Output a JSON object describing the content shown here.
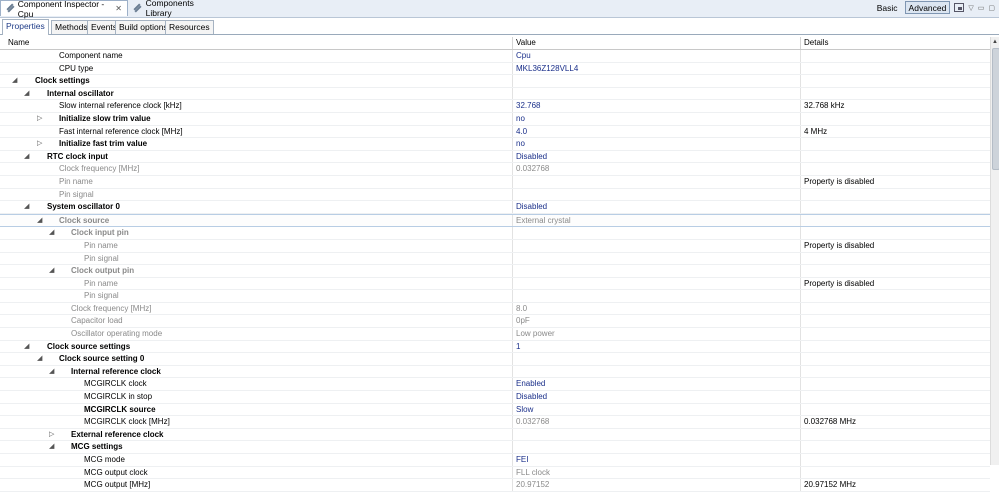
{
  "view_tabs": {
    "inspector": "Component Inspector - Cpu",
    "library": "Components Library",
    "basic": "Basic",
    "advanced": "Advanced"
  },
  "sub_tabs": [
    "Properties",
    "Methods",
    "Events",
    "Build options",
    "Resources"
  ],
  "columns": {
    "name": "Name",
    "value": "Value",
    "details": "Details"
  },
  "rows": [
    {
      "level": 2,
      "tw": "",
      "name": "Component name",
      "value": "Cpu",
      "details": "",
      "bold": false,
      "dis": false
    },
    {
      "level": 2,
      "tw": "",
      "name": "CPU type",
      "value": "MKL36Z128VLL4",
      "details": "",
      "bold": false,
      "dis": false
    },
    {
      "level": 0,
      "tw": "◢",
      "name": "Clock settings",
      "value": "",
      "details": "",
      "bold": true,
      "dis": false
    },
    {
      "level": 1,
      "tw": "◢",
      "name": "Internal oscillator",
      "value": "",
      "details": "",
      "bold": true,
      "dis": false
    },
    {
      "level": 2,
      "tw": "",
      "name": "Slow internal reference clock [kHz]",
      "value": "32.768",
      "details": "32.768 kHz",
      "bold": false,
      "dis": false
    },
    {
      "level": 2,
      "tw": "▷",
      "name": "Initialize slow trim value",
      "value": "no",
      "details": "",
      "bold": true,
      "dis": false
    },
    {
      "level": 2,
      "tw": "",
      "name": "Fast internal reference clock [MHz]",
      "value": "4.0",
      "details": "4 MHz",
      "bold": false,
      "dis": false
    },
    {
      "level": 2,
      "tw": "▷",
      "name": "Initialize fast trim value",
      "value": "no",
      "details": "",
      "bold": true,
      "dis": false
    },
    {
      "level": 1,
      "tw": "◢",
      "name": "RTC clock input",
      "value": "Disabled",
      "details": "",
      "bold": true,
      "dis": false
    },
    {
      "level": 2,
      "tw": "",
      "name": "Clock frequency [MHz]",
      "value": "0.032768",
      "details": "",
      "bold": false,
      "dis": true
    },
    {
      "level": 2,
      "tw": "",
      "name": "Pin name",
      "value": "",
      "details": "Property is disabled",
      "bold": false,
      "dis": true
    },
    {
      "level": 2,
      "tw": "",
      "name": "Pin signal",
      "value": "",
      "details": "",
      "bold": false,
      "dis": true
    },
    {
      "level": 1,
      "tw": "◢",
      "name": "System oscillator 0",
      "value": "Disabled",
      "details": "",
      "bold": true,
      "dis": false
    },
    {
      "level": 2,
      "tw": "◢",
      "name": "Clock source",
      "value": "External crystal",
      "details": "",
      "bold": true,
      "dis": true,
      "hl": true
    },
    {
      "level": 3,
      "tw": "◢",
      "name": "Clock input pin",
      "value": "",
      "details": "",
      "bold": true,
      "dis": true
    },
    {
      "level": 4,
      "tw": "",
      "name": "Pin name",
      "value": "",
      "details": "Property is disabled",
      "bold": false,
      "dis": true
    },
    {
      "level": 4,
      "tw": "",
      "name": "Pin signal",
      "value": "",
      "details": "",
      "bold": false,
      "dis": true
    },
    {
      "level": 3,
      "tw": "◢",
      "name": "Clock output pin",
      "value": "",
      "details": "",
      "bold": true,
      "dis": true
    },
    {
      "level": 4,
      "tw": "",
      "name": "Pin name",
      "value": "",
      "details": "Property is disabled",
      "bold": false,
      "dis": true
    },
    {
      "level": 4,
      "tw": "",
      "name": "Pin signal",
      "value": "",
      "details": "",
      "bold": false,
      "dis": true
    },
    {
      "level": 3,
      "tw": "",
      "name": "Clock frequency [MHz]",
      "value": "8.0",
      "details": "",
      "bold": false,
      "dis": true
    },
    {
      "level": 3,
      "tw": "",
      "name": "Capacitor load",
      "value": "0pF",
      "details": "",
      "bold": false,
      "dis": true
    },
    {
      "level": 3,
      "tw": "",
      "name": "Oscillator operating mode",
      "value": "Low power",
      "details": "",
      "bold": false,
      "dis": true
    },
    {
      "level": 1,
      "tw": "◢",
      "name": "Clock source settings",
      "value": "1",
      "details": "",
      "bold": true,
      "dis": false
    },
    {
      "level": 2,
      "tw": "◢",
      "name": "Clock source setting 0",
      "value": "",
      "details": "",
      "bold": true,
      "dis": false
    },
    {
      "level": 3,
      "tw": "◢",
      "name": "Internal reference clock",
      "value": "",
      "details": "",
      "bold": true,
      "dis": false
    },
    {
      "level": 4,
      "tw": "",
      "name": "MCGIRCLK clock",
      "value": "Enabled",
      "details": "",
      "bold": false,
      "dis": false
    },
    {
      "level": 4,
      "tw": "",
      "name": "MCGIRCLK in stop",
      "value": "Disabled",
      "details": "",
      "bold": false,
      "dis": false
    },
    {
      "level": 4,
      "tw": "",
      "name": "MCGIRCLK source",
      "value": "Slow",
      "details": "",
      "bold": true,
      "dis": false
    },
    {
      "level": 4,
      "tw": "",
      "name": "MCGIRCLK clock [MHz]",
      "value": "0.032768",
      "details": "0.032768 MHz",
      "bold": false,
      "dis": false,
      "vgray": true
    },
    {
      "level": 3,
      "tw": "▷",
      "name": "External reference clock",
      "value": "",
      "details": "",
      "bold": true,
      "dis": false
    },
    {
      "level": 3,
      "tw": "◢",
      "name": "MCG settings",
      "value": "",
      "details": "",
      "bold": true,
      "dis": false
    },
    {
      "level": 4,
      "tw": "",
      "name": "MCG mode",
      "value": "FEI",
      "details": "",
      "bold": false,
      "dis": false
    },
    {
      "level": 4,
      "tw": "",
      "name": "MCG output clock",
      "value": "FLL clock",
      "details": "",
      "bold": false,
      "dis": false,
      "vgray": true
    },
    {
      "level": 4,
      "tw": "",
      "name": "MCG output [MHz]",
      "value": "20.97152",
      "details": "20.97152 MHz",
      "bold": false,
      "dis": false,
      "vgray": true
    }
  ]
}
